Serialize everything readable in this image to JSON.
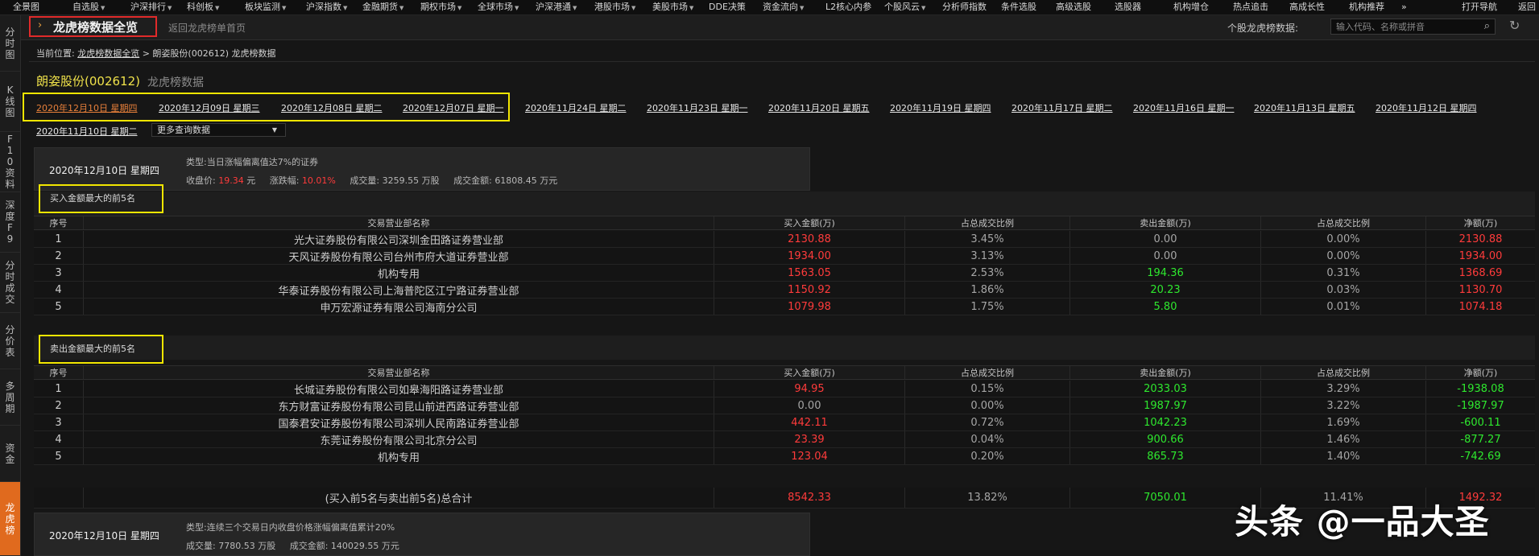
{
  "top_menu": [
    {
      "label": "全景图",
      "arrow": false
    },
    {
      "label": "自选股",
      "arrow": true
    },
    {
      "label": "沪深排行",
      "arrow": true
    },
    {
      "label": "科创板",
      "arrow": true
    },
    {
      "label": "板块监测",
      "arrow": true
    },
    {
      "label": "沪深指数",
      "arrow": true
    },
    {
      "label": "金融期货",
      "arrow": true
    },
    {
      "label": "期权市场",
      "arrow": true
    },
    {
      "label": "全球市场",
      "arrow": true
    },
    {
      "label": "沪深港通",
      "arrow": true
    },
    {
      "label": "港股市场",
      "arrow": true
    },
    {
      "label": "美股市场",
      "arrow": true
    },
    {
      "label": "DDE决策",
      "arrow": false
    },
    {
      "label": "资金流向",
      "arrow": true
    },
    {
      "label": "L2核心内参",
      "arrow": false
    },
    {
      "label": "个股风云",
      "arrow": true
    },
    {
      "label": "分析师指数",
      "arrow": false
    },
    {
      "label": "条件选股",
      "arrow": false
    },
    {
      "label": "高级选股",
      "arrow": false
    },
    {
      "label": "选股器",
      "arrow": false
    },
    {
      "label": "机构增仓",
      "arrow": false
    },
    {
      "label": "热点追击",
      "arrow": false
    },
    {
      "label": "高成长性",
      "arrow": false
    },
    {
      "label": "机构推荐",
      "arrow": false
    },
    {
      "label": "»",
      "arrow": false
    },
    {
      "label": "打开导航",
      "arrow": false
    },
    {
      "label": "返回",
      "arrow": false
    }
  ],
  "sidebar": [
    {
      "label": "分时图"
    },
    {
      "label": "K线图"
    },
    {
      "label": "F10资料"
    },
    {
      "label": "深度F9"
    },
    {
      "label": "分时成交"
    },
    {
      "label": "分价表"
    },
    {
      "label": "多周期"
    },
    {
      "label": "资金"
    },
    {
      "label": "龙虎榜"
    }
  ],
  "titlebar": {
    "title": "龙虎榜数据全览",
    "back_link": "返回龙虎榜单首页",
    "search_label": "个股龙虎榜数据:",
    "search_placeholder": "输入代码、名称或拼音"
  },
  "breadcrumb": {
    "prefix": "当前位置:",
    "link": "龙虎榜数据全览",
    "rest": " > 朗姿股份(002612) 龙虎榜数据"
  },
  "stock": {
    "name": "朗姿股份(002612)",
    "subtitle": "龙虎榜数据"
  },
  "dates": [
    "2020年12月10日 星期四",
    "2020年12月09日 星期三",
    "2020年12月08日 星期二",
    "2020年12月07日 星期一",
    "2020年11月24日 星期二",
    "2020年11月23日 星期一",
    "2020年11月20日 星期五",
    "2020年11月19日 星期四",
    "2020年11月17日 星期二",
    "2020年11月16日 星期一",
    "2020年11月13日 星期五",
    "2020年11月12日 星期四",
    "2020年11月10日 星期二"
  ],
  "more_dates_label": "更多查询数据",
  "section1": {
    "date": "2020年12月10日 星期四",
    "type": "类型:当日涨幅偏离值达7%的证券",
    "close_label": "收盘价:",
    "close_value": "19.34",
    "close_unit": "元",
    "change_label": "涨跌幅:",
    "change_value": "10.01%",
    "volume_label": "成交量:",
    "volume_value": "3259.55 万股",
    "amount_label": "成交金额:",
    "amount_value": "61808.45 万元"
  },
  "table_headers": {
    "seq": "序号",
    "name": "交易营业部名称",
    "buy": "买入金额(万)",
    "buy_pct": "占总成交比例",
    "sell": "卖出金额(万)",
    "sell_pct": "占总成交比例",
    "net": "净额(万)"
  },
  "buy_section_label": "买入金额最大的前5名",
  "buy_rows": [
    {
      "seq": "1",
      "name": "光大证券股份有限公司深圳金田路证券营业部",
      "buy": "2130.88",
      "buy_pct": "3.45%",
      "sell": "0.00",
      "sell_pct": "0.00%",
      "net": "2130.88",
      "sell_color": "grey",
      "net_color": "red"
    },
    {
      "seq": "2",
      "name": "天风证券股份有限公司台州市府大道证券营业部",
      "buy": "1934.00",
      "buy_pct": "3.13%",
      "sell": "0.00",
      "sell_pct": "0.00%",
      "net": "1934.00",
      "sell_color": "grey",
      "net_color": "red"
    },
    {
      "seq": "3",
      "name": "机构专用",
      "buy": "1563.05",
      "buy_pct": "2.53%",
      "sell": "194.36",
      "sell_pct": "0.31%",
      "net": "1368.69",
      "sell_color": "green",
      "net_color": "red"
    },
    {
      "seq": "4",
      "name": "华泰证券股份有限公司上海普陀区江宁路证券营业部",
      "buy": "1150.92",
      "buy_pct": "1.86%",
      "sell": "20.23",
      "sell_pct": "0.03%",
      "net": "1130.70",
      "sell_color": "green",
      "net_color": "red"
    },
    {
      "seq": "5",
      "name": "申万宏源证券有限公司海南分公司",
      "buy": "1079.98",
      "buy_pct": "1.75%",
      "sell": "5.80",
      "sell_pct": "0.01%",
      "net": "1074.18",
      "sell_color": "green",
      "net_color": "red"
    }
  ],
  "sell_section_label": "卖出金额最大的前5名",
  "sell_rows": [
    {
      "seq": "1",
      "name": "长城证券股份有限公司如皋海阳路证券营业部",
      "buy": "94.95",
      "buy_pct": "0.15%",
      "sell": "2033.03",
      "sell_pct": "3.29%",
      "net": "-1938.08",
      "buy_color": "red",
      "net_color": "green"
    },
    {
      "seq": "2",
      "name": "东方财富证券股份有限公司昆山前进西路证券营业部",
      "buy": "0.00",
      "buy_pct": "0.00%",
      "sell": "1987.97",
      "sell_pct": "3.22%",
      "net": "-1987.97",
      "buy_color": "grey",
      "net_color": "green"
    },
    {
      "seq": "3",
      "name": "国泰君安证券股份有限公司深圳人民南路证券营业部",
      "buy": "442.11",
      "buy_pct": "0.72%",
      "sell": "1042.23",
      "sell_pct": "1.69%",
      "net": "-600.11",
      "buy_color": "red",
      "net_color": "green"
    },
    {
      "seq": "4",
      "name": "东莞证券股份有限公司北京分公司",
      "buy": "23.39",
      "buy_pct": "0.04%",
      "sell": "900.66",
      "sell_pct": "1.46%",
      "net": "-877.27",
      "buy_color": "red",
      "net_color": "green"
    },
    {
      "seq": "5",
      "name": "机构专用",
      "buy": "123.04",
      "buy_pct": "0.20%",
      "sell": "865.73",
      "sell_pct": "1.40%",
      "net": "-742.69",
      "buy_color": "red",
      "net_color": "green"
    }
  ],
  "total_row": {
    "name": "(买入前5名与卖出前5名)总合计",
    "buy": "8542.33",
    "buy_pct": "13.82%",
    "sell": "7050.01",
    "sell_pct": "11.41%",
    "net": "1492.32"
  },
  "section2": {
    "date": "2020年12月10日 星期四",
    "type": "类型:连续三个交易日内收盘价格涨幅偏离值累计20%",
    "volume_label": "成交量:",
    "volume_value": "7780.53 万股",
    "amount_label": "成交金额:",
    "amount_value": "140029.55 万元"
  },
  "watermark": "头条 @一品大圣",
  "colors": {
    "up": "#ff3b3b",
    "down": "#2ee82e",
    "accent": "#e06a1e",
    "highlight": "#f2e600",
    "title_box": "#e02a2a"
  }
}
